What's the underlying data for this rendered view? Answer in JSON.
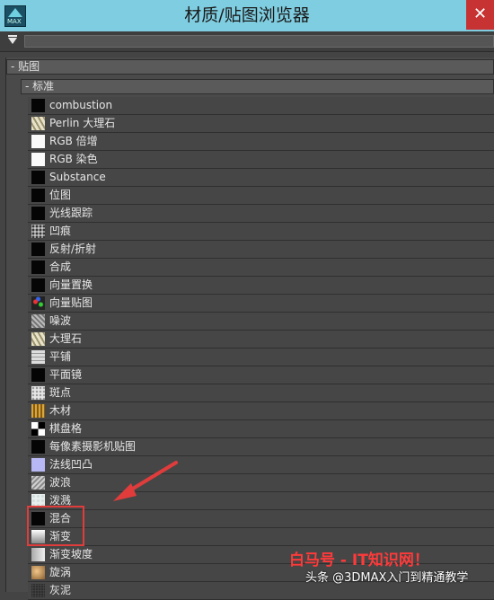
{
  "window": {
    "title": "材质/贴图浏览器",
    "close_label": "✕"
  },
  "app_icon_text": "MAX",
  "filter": {
    "placeholder": ""
  },
  "tree": {
    "group_label": "- 贴图",
    "subgroup_label": "- 标准"
  },
  "items": [
    {
      "label": "combustion",
      "swatch": "black"
    },
    {
      "label": "Perlin 大理石",
      "swatch": "marble"
    },
    {
      "label": "RGB 倍增",
      "swatch": "white"
    },
    {
      "label": "RGB 染色",
      "swatch": "white"
    },
    {
      "label": "Substance",
      "swatch": "black"
    },
    {
      "label": "位图",
      "swatch": "black"
    },
    {
      "label": "光线跟踪",
      "swatch": "black"
    },
    {
      "label": "凹痕",
      "swatch": "cellular"
    },
    {
      "label": "反射/折射",
      "swatch": "black"
    },
    {
      "label": "合成",
      "swatch": "black"
    },
    {
      "label": "向量置换",
      "swatch": "black"
    },
    {
      "label": "向量贴图",
      "swatch": "vector"
    },
    {
      "label": "噪波",
      "swatch": "noise"
    },
    {
      "label": "大理石",
      "swatch": "marble"
    },
    {
      "label": "平铺",
      "swatch": "tile"
    },
    {
      "label": "平面镜",
      "swatch": "black"
    },
    {
      "label": "斑点",
      "swatch": "speckle"
    },
    {
      "label": "木材",
      "swatch": "wood"
    },
    {
      "label": "棋盘格",
      "swatch": "check"
    },
    {
      "label": "每像素摄影机贴图",
      "swatch": "black"
    },
    {
      "label": "法线凹凸",
      "swatch": "lavender"
    },
    {
      "label": "波浪",
      "swatch": "wave"
    },
    {
      "label": "泼溅",
      "swatch": "splash"
    },
    {
      "label": "混合",
      "swatch": "black"
    },
    {
      "label": "渐变",
      "swatch": "gradient"
    },
    {
      "label": "渐变坡度",
      "swatch": "ramp"
    },
    {
      "label": "旋涡",
      "swatch": "swirl"
    },
    {
      "label": "灰泥",
      "swatch": "smoke"
    }
  ],
  "overlay": {
    "watermark": "白马号 - IT知识网！",
    "credit": "头条 @3DMAX入门到精通教学",
    "highlight_color": "#e03c3c"
  }
}
